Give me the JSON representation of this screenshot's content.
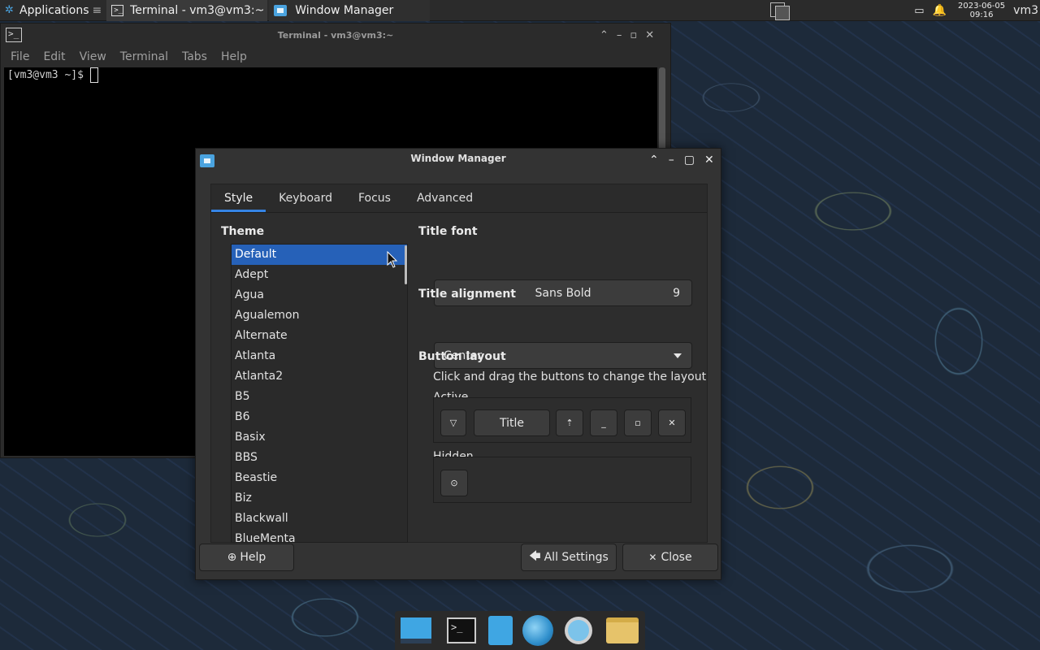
{
  "top_panel": {
    "apps_label": "Applications",
    "apps_extra": "≡",
    "tasks": [
      {
        "label": "Terminal - vm3@vm3:~",
        "icon": "terminal-icon"
      },
      {
        "label": "Window Manager",
        "icon": "window-manager-icon"
      }
    ],
    "clock_date": "2023-06-05",
    "clock_time": "09:16",
    "user": "vm3"
  },
  "terminal": {
    "title": "Terminal - vm3@vm3:~",
    "menu": [
      "File",
      "Edit",
      "View",
      "Terminal",
      "Tabs",
      "Help"
    ],
    "prompt": "[vm3@vm3 ~]$ "
  },
  "wm_dialog": {
    "title": "Window Manager",
    "tabs": [
      {
        "label": "Style",
        "accel": "S",
        "active": true
      },
      {
        "label": "Keyboard",
        "accel": "K",
        "active": false
      },
      {
        "label": "Focus",
        "accel": "F",
        "active": false
      },
      {
        "label": "Advanced",
        "accel": "A",
        "active": false
      }
    ],
    "theme_label": "Theme",
    "themes": [
      "Default",
      "Adept",
      "Agua",
      "Agualemon",
      "Alternate",
      "Atlanta",
      "Atlanta2",
      "B5",
      "B6",
      "Basix",
      "BBS",
      "Beastie",
      "Biz",
      "Blackwall",
      "BlueMenta"
    ],
    "selected_theme": "Default",
    "title_font_label": "Title font",
    "title_font_name": "Sans Bold",
    "title_font_size": "9",
    "title_alignment_label": "Title alignment",
    "title_alignment_value": "Center",
    "button_layout_label": "Button layout",
    "button_layout_hint": "Click and drag the buttons to change the layout",
    "active_label": "Active",
    "active_title": "Title",
    "hidden_label": "Hidden",
    "help_label": "Help",
    "all_settings_label": "All Settings",
    "close_label": "Close"
  },
  "colors": {
    "accent": "#3584e4",
    "selection": "#2661b8",
    "dialog_bg": "#333333"
  }
}
